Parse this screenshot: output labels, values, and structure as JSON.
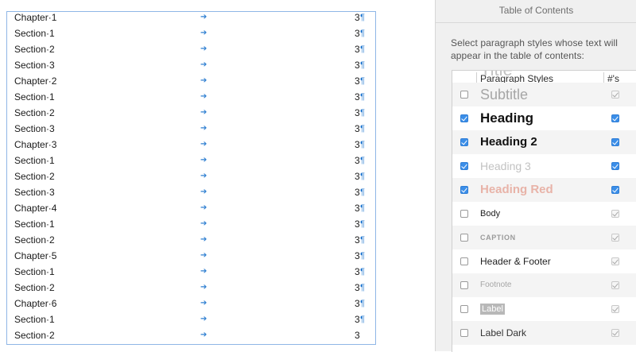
{
  "document": {
    "toc_entries": [
      {
        "title": "Chapter·1",
        "page": "3",
        "pilcrow": "¶"
      },
      {
        "title": "Section·1",
        "page": "3",
        "pilcrow": "¶"
      },
      {
        "title": "Section·2",
        "page": "3",
        "pilcrow": "¶"
      },
      {
        "title": "Section·3",
        "page": "3",
        "pilcrow": "¶"
      },
      {
        "title": "Chapter·2",
        "page": "3",
        "pilcrow": "¶"
      },
      {
        "title": "Section·1",
        "page": "3",
        "pilcrow": "¶"
      },
      {
        "title": "Section·2",
        "page": "3",
        "pilcrow": "¶"
      },
      {
        "title": "Section·3",
        "page": "3",
        "pilcrow": "¶"
      },
      {
        "title": "Chapter·3",
        "page": "3",
        "pilcrow": "¶"
      },
      {
        "title": "Section·1",
        "page": "3",
        "pilcrow": "¶"
      },
      {
        "title": "Section·2",
        "page": "3",
        "pilcrow": "¶"
      },
      {
        "title": "Section·3",
        "page": "3",
        "pilcrow": "¶"
      },
      {
        "title": "Chapter·4",
        "page": "3",
        "pilcrow": "¶"
      },
      {
        "title": "Section·1",
        "page": "3",
        "pilcrow": "¶"
      },
      {
        "title": "Section·2",
        "page": "3",
        "pilcrow": "¶"
      },
      {
        "title": "Chapter·5",
        "page": "3",
        "pilcrow": "¶"
      },
      {
        "title": "Section·1",
        "page": "3",
        "pilcrow": "¶"
      },
      {
        "title": "Section·2",
        "page": "3",
        "pilcrow": "¶"
      },
      {
        "title": "Chapter·6",
        "page": "3",
        "pilcrow": "¶"
      },
      {
        "title": "Section·1",
        "page": "3",
        "pilcrow": "¶"
      },
      {
        "title": "Section·2",
        "page": "3",
        "pilcrow": ""
      }
    ],
    "tab_arrow": "➔"
  },
  "panel": {
    "title": "Table of Contents",
    "description": "Select paragraph styles whose text will appear in the table of contents:",
    "table": {
      "col_styles": "Paragraph Styles",
      "col_numbers": "#'s",
      "rows": [
        {
          "name": "Title",
          "include": false,
          "numbers": true
        },
        {
          "name": "Subtitle",
          "include": false,
          "numbers": true
        },
        {
          "name": "Heading",
          "include": true,
          "numbers": true
        },
        {
          "name": "Heading 2",
          "include": true,
          "numbers": true
        },
        {
          "name": "Heading 3",
          "include": true,
          "numbers": true
        },
        {
          "name": "Heading Red",
          "include": true,
          "numbers": true
        },
        {
          "name": "Body",
          "include": false,
          "numbers": true
        },
        {
          "name": "CAPTION",
          "include": false,
          "numbers": true
        },
        {
          "name": "Header & Footer",
          "include": false,
          "numbers": true
        },
        {
          "name": "Footnote",
          "include": false,
          "numbers": true
        },
        {
          "name": "Label",
          "include": false,
          "numbers": true
        },
        {
          "name": "Label Dark",
          "include": false,
          "numbers": true
        }
      ]
    }
  },
  "colors": {
    "accent_blue": "#3b8ee8",
    "heading_red": "#e8b3a8",
    "toc_frame": "#8fb6e6"
  }
}
